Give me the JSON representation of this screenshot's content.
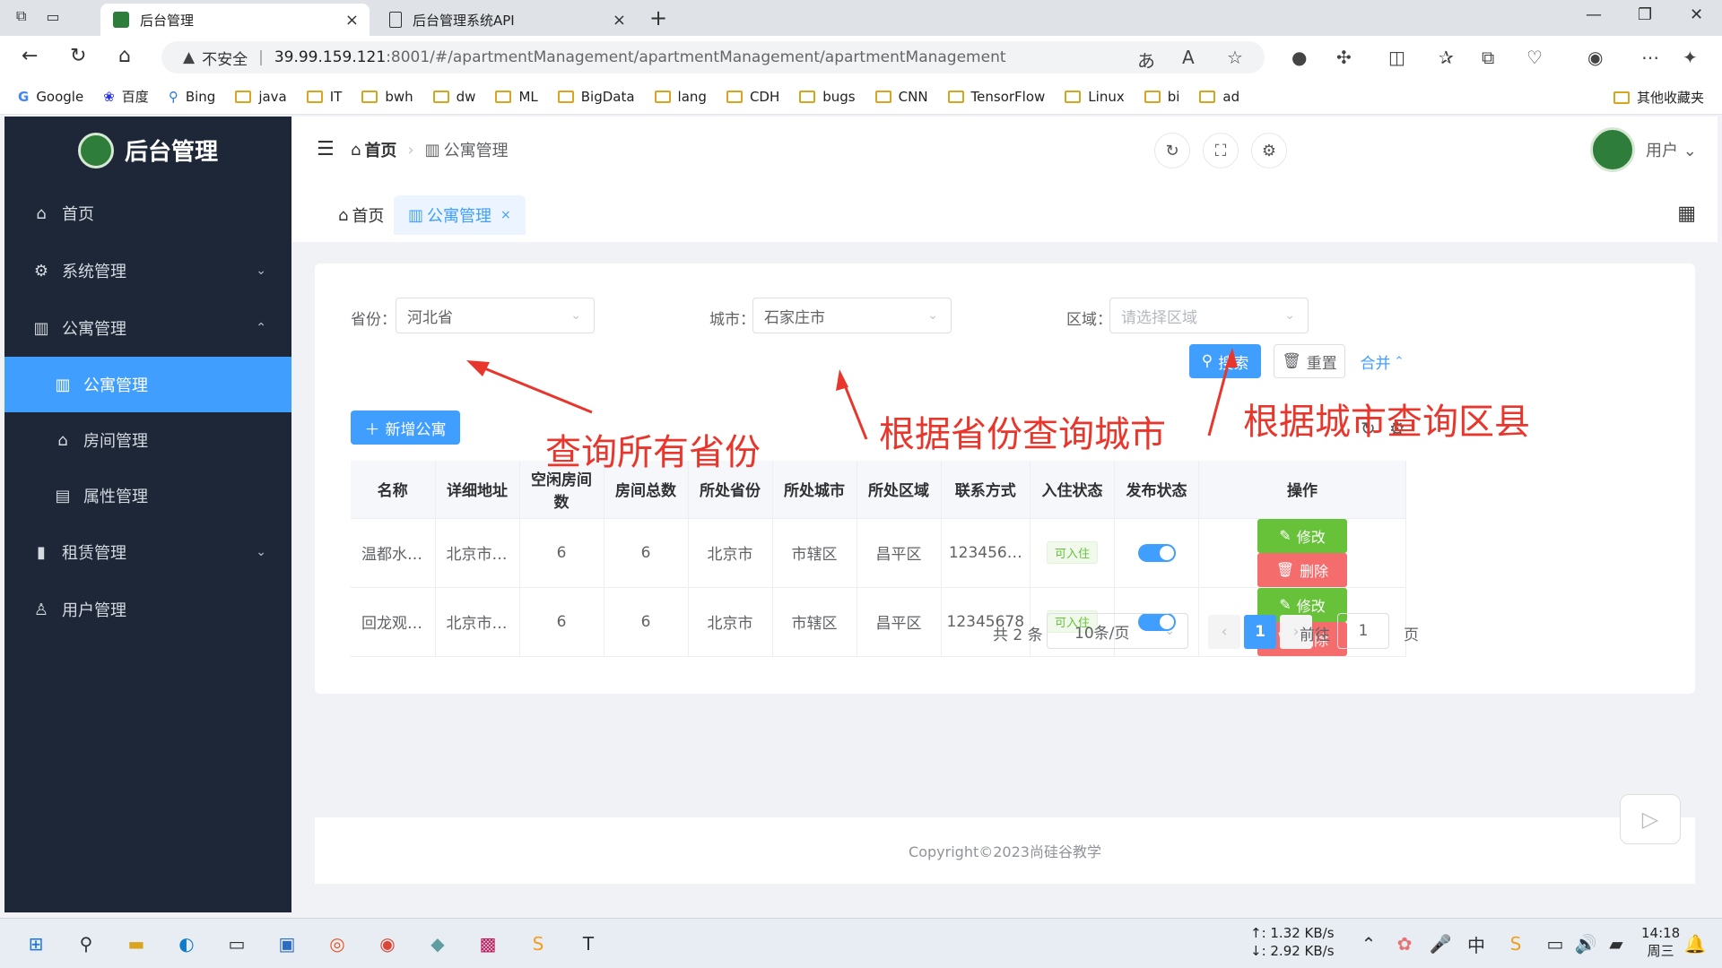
{
  "browser": {
    "tabs": [
      {
        "label": "后台管理",
        "active": true
      },
      {
        "label": "后台管理系统API",
        "active": false
      }
    ],
    "security_label": "不安全",
    "url_host": "39.99.159.121",
    "url_path": ":8001/#/apartmentManagement/apartmentManagement/apartmentManagement",
    "bookmarks": [
      "Google",
      "百度",
      "Bing",
      "java",
      "IT",
      "bwh",
      "dw",
      "ML",
      "BigData",
      "lang",
      "CDH",
      "bugs",
      "CNN",
      "TensorFlow",
      "Linux",
      "bi",
      "ad"
    ],
    "other_bookmarks": "其他收藏夹"
  },
  "sidebar": {
    "title": "后台管理",
    "items": [
      {
        "label": "首页",
        "icon": "home-icon"
      },
      {
        "label": "系统管理",
        "icon": "gear-icon"
      },
      {
        "label": "公寓管理",
        "icon": "building-icon"
      },
      {
        "label": "公寓管理",
        "icon": "building-icon"
      },
      {
        "label": "房间管理",
        "icon": "house-icon"
      },
      {
        "label": "属性管理",
        "icon": "clipboard-icon"
      },
      {
        "label": "租赁管理",
        "icon": "chart-icon"
      },
      {
        "label": "用户管理",
        "icon": "user-icon"
      }
    ]
  },
  "header": {
    "breadcrumb_home": "首页",
    "breadcrumb_current": "公寓管理",
    "user_label": "用户"
  },
  "tags": {
    "home": "首页",
    "current": "公寓管理",
    "close": "×"
  },
  "filters": {
    "province_label": "省份：",
    "province_value": "河北省",
    "city_label": "城市：",
    "city_value": "石家庄市",
    "district_label": "区域：",
    "district_placeholder": "请选择区域",
    "search": "搜索",
    "reset": "重置",
    "collapse": "合并"
  },
  "add_button": "新增公寓",
  "table": {
    "headers": [
      "名称",
      "详细地址",
      "空闲房间数",
      "房间总数",
      "所处省份",
      "所处城市",
      "所处区域",
      "联系方式",
      "入住状态",
      "发布状态",
      "操作"
    ],
    "rows": [
      {
        "name": "温都水…",
        "address": "北京市…",
        "free": "6",
        "total": "6",
        "province": "北京市",
        "city": "市辖区",
        "district": "昌平区",
        "phone": "123456…",
        "status": "可入住",
        "edit": "修改",
        "delete": "删除"
      },
      {
        "name": "回龙观…",
        "address": "北京市…",
        "free": "6",
        "total": "6",
        "province": "北京市",
        "city": "市辖区",
        "district": "昌平区",
        "phone": "12345678",
        "status": "可入住",
        "edit": "修改",
        "delete": "删除"
      }
    ]
  },
  "pagination": {
    "total": "共 2 条",
    "page_size": "10条/页",
    "current": "1",
    "goto_label": "前往",
    "goto_value": "1",
    "page_suffix": "页"
  },
  "footer": "Copyright©2023尚硅谷教学",
  "annotations": {
    "a1": "查询所有省份",
    "a2": "根据省份查询城市",
    "a3": "根据城市查询区县"
  },
  "taskbar": {
    "upload": "↑: 1.32 KB/s",
    "download": "↓: 2.92 KB/s",
    "time": "14:18",
    "day": "周三"
  }
}
